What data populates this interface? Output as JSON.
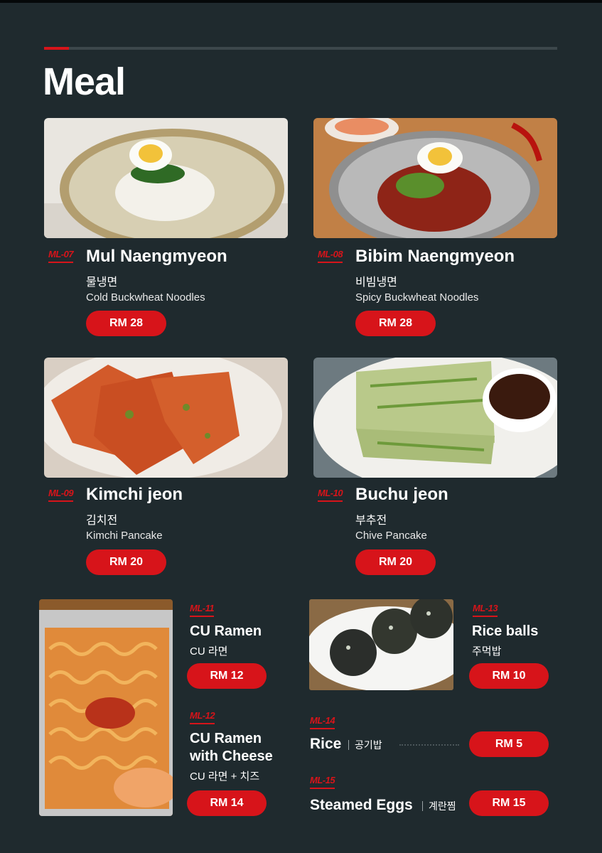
{
  "section": {
    "title": "Meal"
  },
  "colors": {
    "background": "#1f2a2e",
    "accent": "#d7141a"
  },
  "items": [
    {
      "code": "ML-07",
      "name": "Mul Naengmyeon",
      "korean": "물냉면",
      "english": "Cold Buckwheat Noodles",
      "price": "RM 28",
      "image": "cold-noodle-bowl-photo"
    },
    {
      "code": "ML-08",
      "name": "Bibim Naengmyeon",
      "korean": "비빔냉면",
      "english": "Spicy Buckwheat Noodles",
      "price": "RM 28",
      "image": "spicy-noodle-bowl-photo"
    },
    {
      "code": "ML-09",
      "name": "Kimchi jeon",
      "korean": "김치전",
      "english": "Kimchi Pancake",
      "price": "RM 20",
      "image": "kimchi-pancake-photo"
    },
    {
      "code": "ML-10",
      "name": "Buchu jeon",
      "korean": "부추전",
      "english": "Chive Pancake",
      "price": "RM 20",
      "image": "chive-pancake-photo"
    },
    {
      "code": "ML-11",
      "name": "CU Ramen",
      "korean": "CU 라면",
      "price": "RM 12",
      "image": "ramen-tray-photo"
    },
    {
      "code": "ML-12",
      "name_line1": "CU Ramen",
      "name_line2": "with Cheese",
      "korean": "CU 라면 + 치즈",
      "price": "RM 14"
    },
    {
      "code": "ML-13",
      "name": "Rice balls",
      "korean": "주먹밥",
      "price": "RM 10",
      "image": "rice-balls-photo"
    },
    {
      "code": "ML-14",
      "name": "Rice",
      "korean": "공기밥",
      "price": "RM 5"
    },
    {
      "code": "ML-15",
      "name": "Steamed Eggs",
      "korean": "계란찜",
      "price": "RM 15"
    }
  ]
}
